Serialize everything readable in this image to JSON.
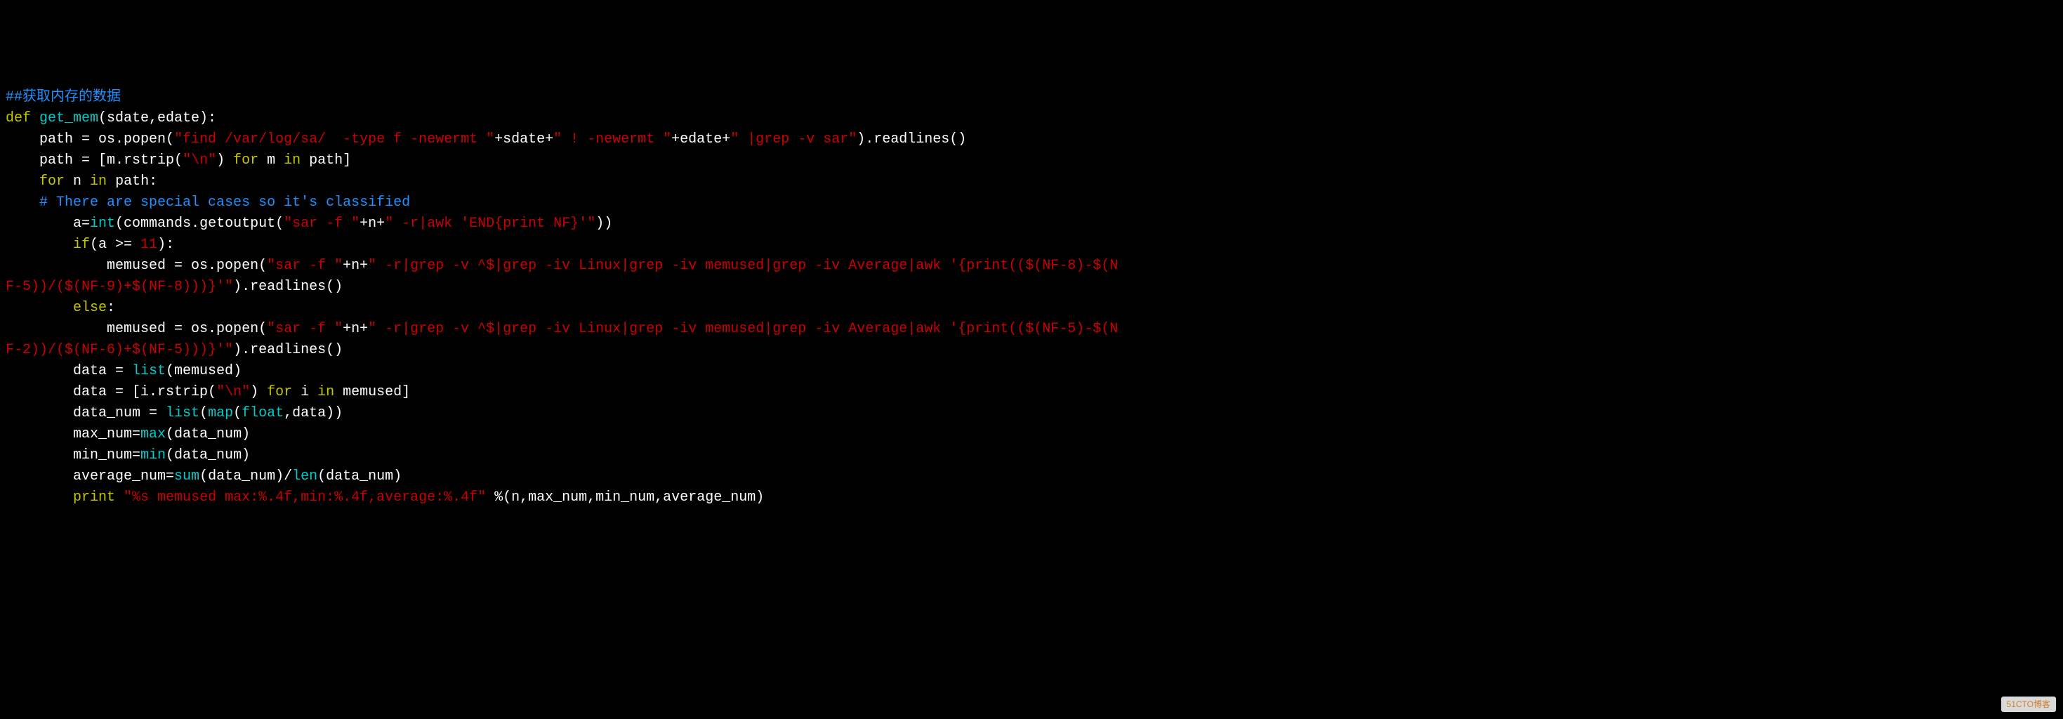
{
  "code": {
    "line1": {
      "comment": "##获取内存的数据"
    },
    "line2": {
      "def": "def",
      "fname": " get_mem",
      "params": "(sdate,edate):"
    },
    "line3": {
      "indent": "    ",
      "text1": "path = os.popen(",
      "str1": "\"find /var/log/sa/  -type f -newermt \"",
      "text2": "+sdate+",
      "str2": "\" ! -newermt \"",
      "text3": "+edate+",
      "str3": "\" |grep -v sar\"",
      "text4": ").readlines()"
    },
    "line4": {
      "indent": "    ",
      "text1": "path = [m.rstrip(",
      "str1": "\"\\n\"",
      "text2": ") ",
      "kw1": "for",
      "text3": " m ",
      "kw2": "in",
      "text4": " path]"
    },
    "line5": {
      "indent": "    ",
      "kw1": "for",
      "text1": " n ",
      "kw2": "in",
      "text2": " path:"
    },
    "line6": {
      "indent": "    ",
      "comment": "# There are special cases so it's classified"
    },
    "line7": {
      "indent": "        ",
      "text1": "a=",
      "builtin1": "int",
      "text2": "(commands.getoutput(",
      "str1": "\"sar -f \"",
      "text3": "+n+",
      "str2": "\" -r|awk 'END{print NF}'\"",
      "text4": "))"
    },
    "line8": {
      "indent": "        ",
      "kw1": "if",
      "text1": "(a >= ",
      "num": "11",
      "text2": "):"
    },
    "line9a": {
      "indent": "            ",
      "text1": "memused = os.popen(",
      "str1": "\"sar -f \"",
      "text2": "+n+",
      "str2": "\" -r|grep -v ^$|grep -iv Linux|grep -iv memused|grep -iv Average|awk '{print(($(NF-8)-$(N"
    },
    "line9b": {
      "str1": "F-5))/($(NF-9)+$(NF-8)))}'\"",
      "text1": ").readlines()"
    },
    "line10": {
      "indent": "        ",
      "kw1": "else",
      "text1": ":"
    },
    "line11a": {
      "indent": "            ",
      "text1": "memused = os.popen(",
      "str1": "\"sar -f \"",
      "text2": "+n+",
      "str2": "\" -r|grep -v ^$|grep -iv Linux|grep -iv memused|grep -iv Average|awk '{print(($(NF-5)-$(N"
    },
    "line11b": {
      "str1": "F-2))/($(NF-6)+$(NF-5)))}'\"",
      "text1": ").readlines()"
    },
    "line12": {
      "indent": "        ",
      "text1": "data = ",
      "builtin1": "list",
      "text2": "(memused)"
    },
    "line13": {
      "indent": "        ",
      "text1": "data = [i.rstrip(",
      "str1": "\"\\n\"",
      "text2": ") ",
      "kw1": "for",
      "text3": " i ",
      "kw2": "in",
      "text4": " memused]"
    },
    "line14": {
      "indent": "        ",
      "text1": "data_num = ",
      "builtin1": "list",
      "text2": "(",
      "builtin2": "map",
      "text3": "(",
      "builtin3": "float",
      "text4": ",data))"
    },
    "line15": {
      "indent": "        ",
      "text1": "max_num=",
      "builtin1": "max",
      "text2": "(data_num)"
    },
    "line16": {
      "indent": "        ",
      "text1": "min_num=",
      "builtin1": "min",
      "text2": "(data_num)"
    },
    "line17": {
      "indent": "        ",
      "text1": "average_num=",
      "builtin1": "sum",
      "text2": "(data_num)/",
      "builtin2": "len",
      "text3": "(data_num)"
    },
    "line18": {
      "indent": "        ",
      "kw1": "print",
      "text1": " ",
      "str1": "\"%s memused max:%.4f,min:%.4f,average:%.4f\"",
      "text2": " %(n,max_num,min_num,average_num)"
    }
  },
  "watermark": "51CTO博客"
}
